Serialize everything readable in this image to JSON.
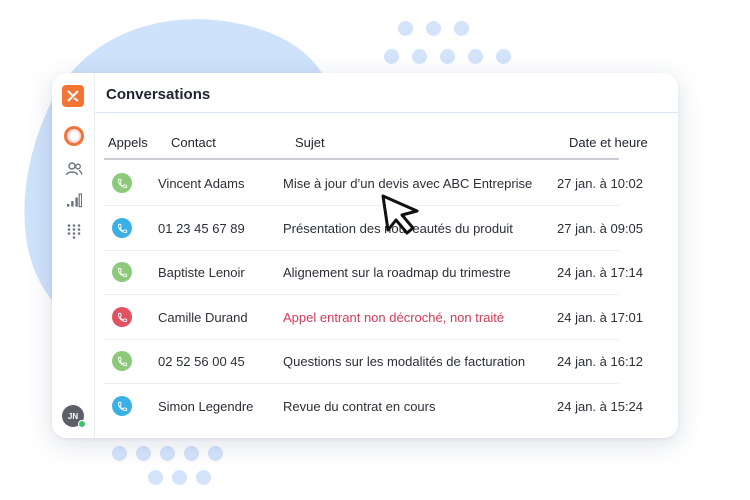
{
  "app": {
    "logo_label": ""
  },
  "header": {
    "title": "Conversations"
  },
  "table": {
    "columns": {
      "calls": "Appels",
      "contact": "Contact",
      "subject": "Sujet",
      "datetime": "Date et heure"
    },
    "rows": [
      {
        "type": "answered",
        "contact": "Vincent Adams",
        "subject": "Mise à jour d’un devis avec ABC Entreprise",
        "datetime": "27 jan. à 10:02"
      },
      {
        "type": "outgoing",
        "contact": "01 23 45 67 89",
        "subject": "Présentation des nouveautés du produit",
        "datetime": "27 jan. à 09:05"
      },
      {
        "type": "answered",
        "contact": "Baptiste Lenoir",
        "subject": "Alignement sur la roadmap du trimestre",
        "datetime": "24 jan. à 17:14"
      },
      {
        "type": "missed",
        "contact": "Camille Durand",
        "subject": "Appel entrant non décroché, non traité",
        "datetime": "24 jan. à 17:01"
      },
      {
        "type": "answered",
        "contact": "02 52 56 00 45",
        "subject": "Questions sur les modalités de facturation",
        "datetime": "24 jan. à 16:12"
      },
      {
        "type": "outgoing",
        "contact": "Simon Legendre",
        "subject": "Revue du contrat en cours",
        "datetime": "24 jan. à 15:24"
      }
    ]
  },
  "sidebar": {
    "items": [
      "chat-icon",
      "contacts-icon",
      "stats-icon",
      "dialpad-icon"
    ],
    "avatar_initials": "JN"
  },
  "colors": {
    "brand": "#f47435",
    "answered": "#8cc97a",
    "outgoing": "#3bb0e6",
    "missed": "#e2515f",
    "missed_text": "#d23b57",
    "background_shape": "#cfe2fb"
  }
}
